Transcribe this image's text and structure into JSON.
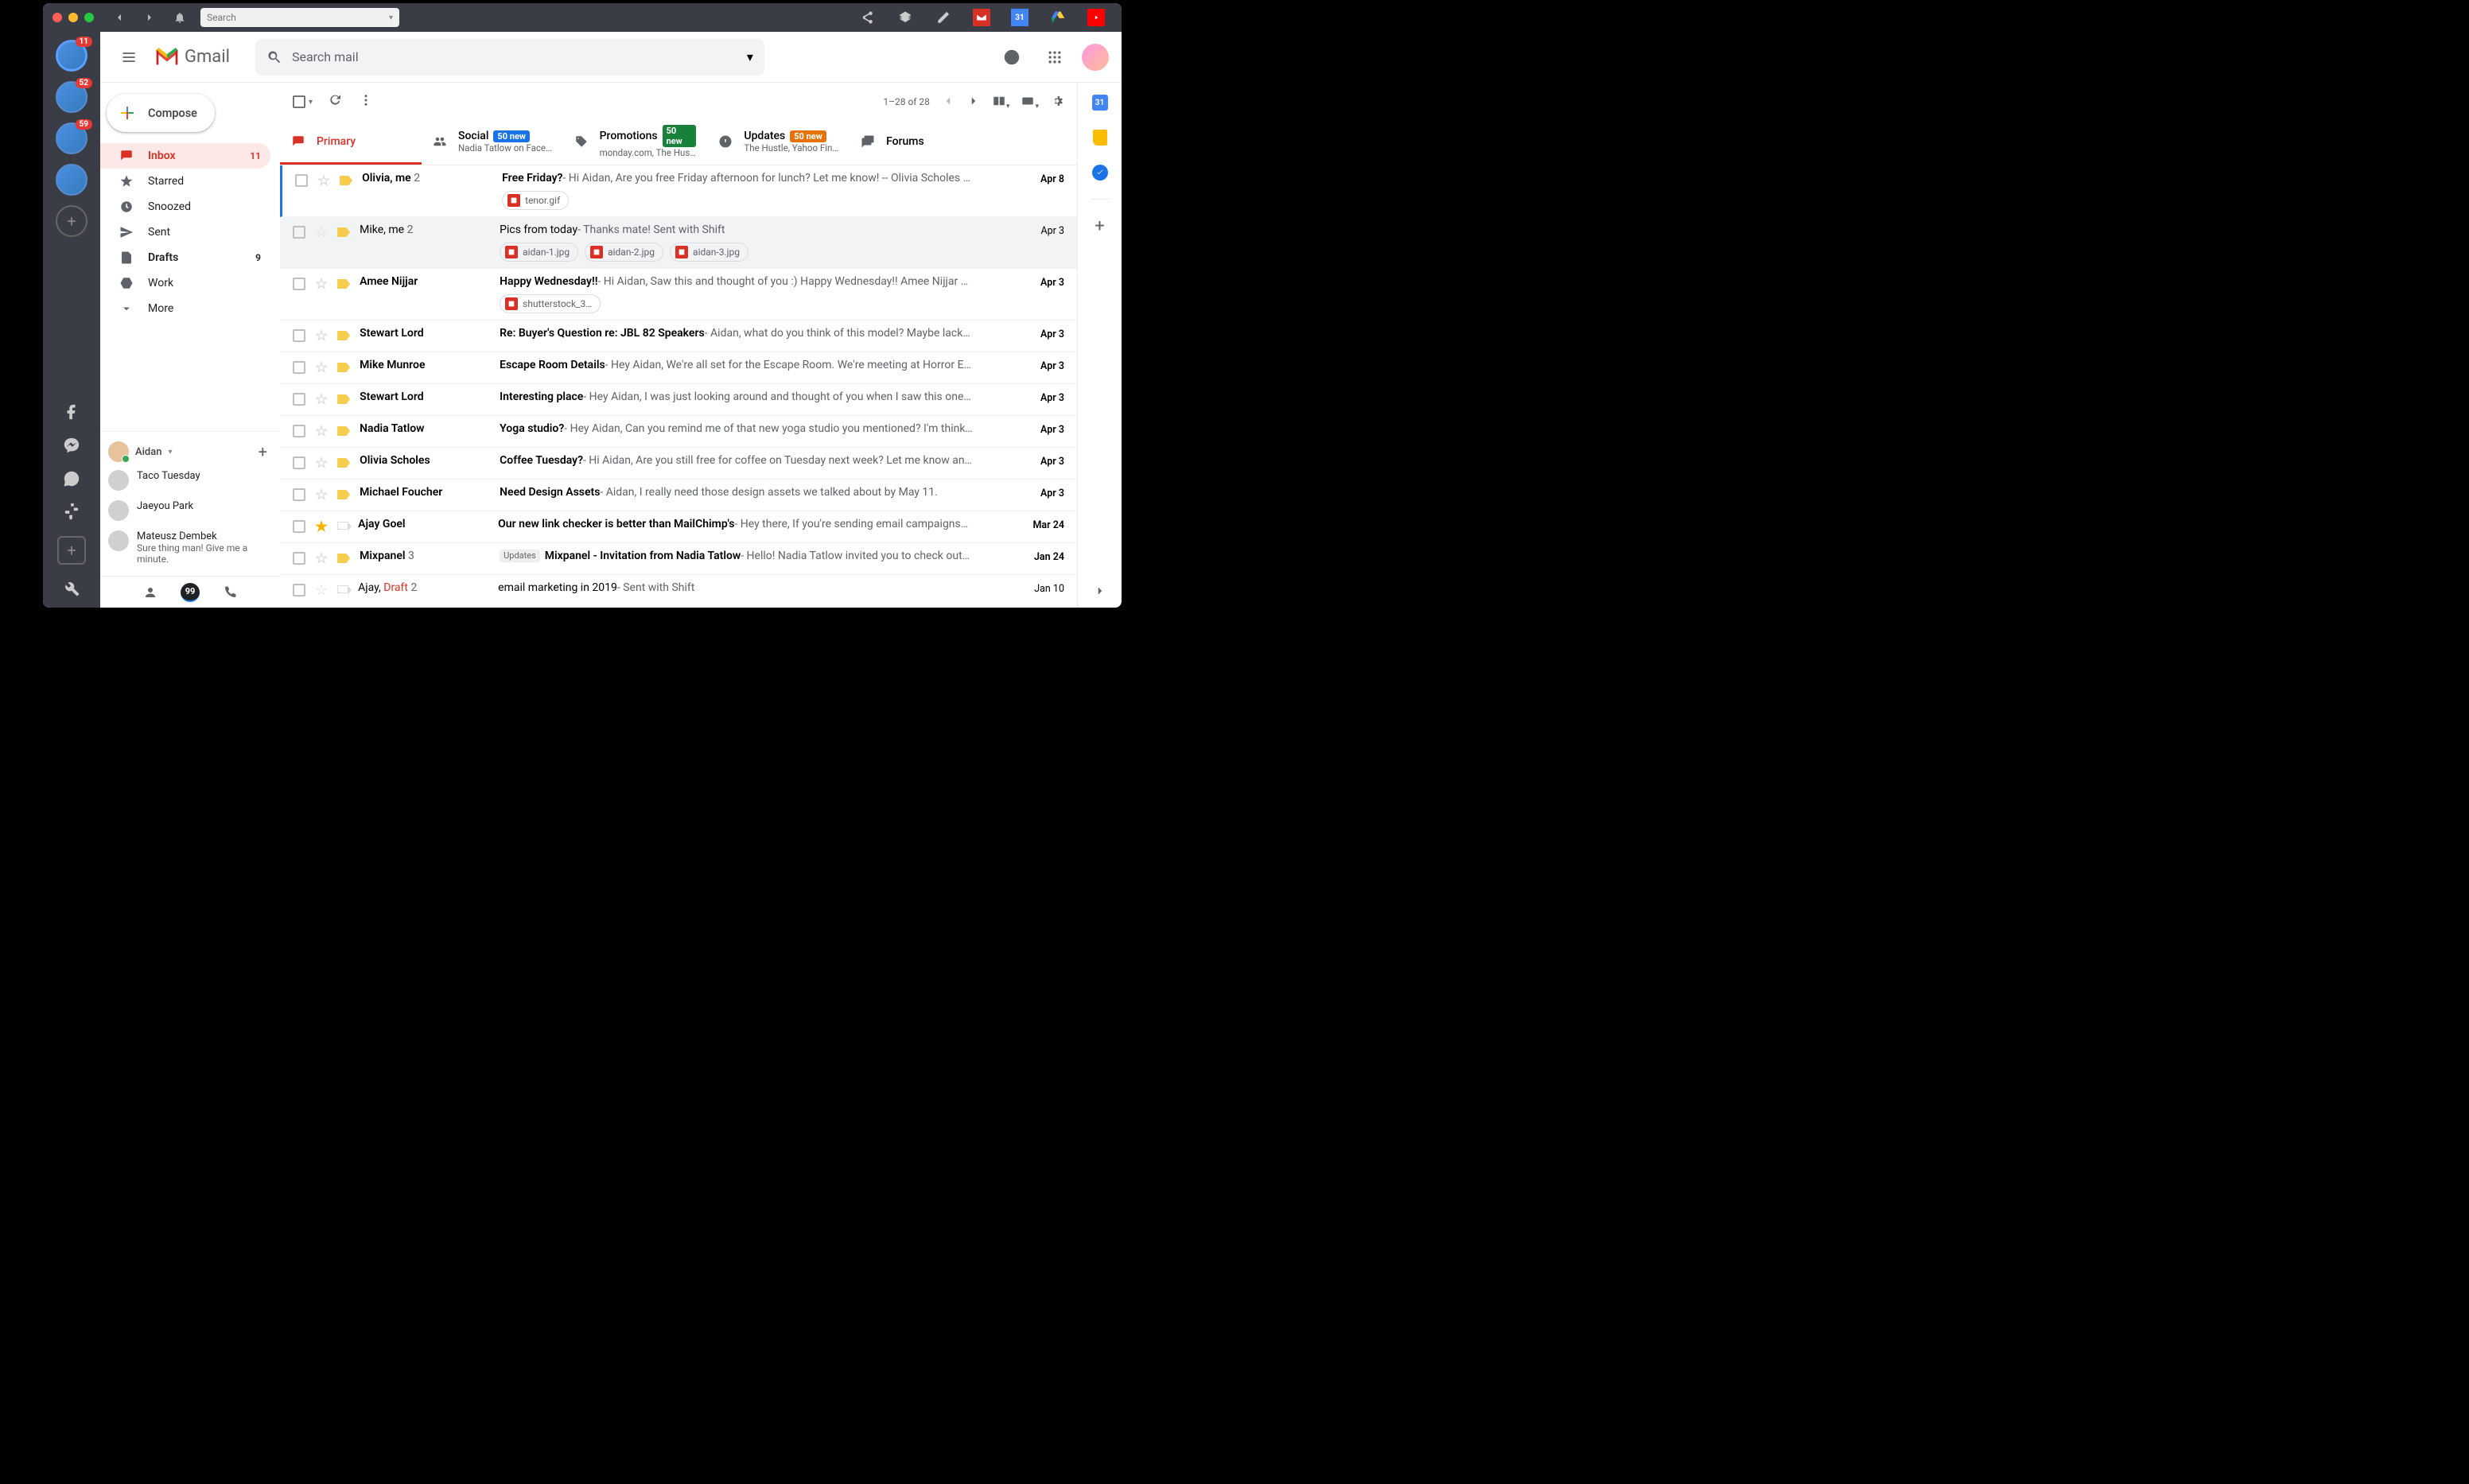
{
  "titlebar": {
    "search_placeholder": "Search"
  },
  "shift_sidebar": {
    "accounts": [
      {
        "badge": "11"
      },
      {
        "badge": "52"
      },
      {
        "badge": "59"
      },
      {
        "badge": null
      }
    ]
  },
  "gmail": {
    "brand": "Gmail",
    "search_placeholder": "Search mail",
    "compose": "Compose",
    "pagination": "1–28 of 28",
    "nav": {
      "inbox": {
        "label": "Inbox",
        "count": "11"
      },
      "starred": {
        "label": "Starred"
      },
      "snoozed": {
        "label": "Snoozed"
      },
      "sent": {
        "label": "Sent"
      },
      "drafts": {
        "label": "Drafts",
        "count": "9"
      },
      "work": {
        "label": "Work"
      },
      "more": {
        "label": "More"
      }
    },
    "tabs": {
      "primary": {
        "label": "Primary"
      },
      "social": {
        "label": "Social",
        "pill": "50 new",
        "sub": "Nadia Tatlow on Face…"
      },
      "promotions": {
        "label": "Promotions",
        "pill": "50 new",
        "sub": "monday.com, The Hus…"
      },
      "updates": {
        "label": "Updates",
        "pill": "50 new",
        "sub": "The Hustle, Yahoo Fin…"
      },
      "forums": {
        "label": "Forums"
      }
    },
    "hangouts": {
      "me": "Aidan",
      "contacts": [
        {
          "name": "Taco Tuesday"
        },
        {
          "name": "Jaeyou Park"
        },
        {
          "name": "Mateusz Dembek",
          "msg": "Sure thing man! Give me a minute."
        }
      ],
      "mid_badge": "99"
    },
    "side_cal": "31"
  },
  "emails": [
    {
      "sender": "Olivia, me",
      "cnt": "2",
      "subject": "Free Friday?",
      "snippet": " - Hi Aidan, Are you free Friday afternoon for lunch? Let me know! -- Olivia Scholes …",
      "date": "Apr 8",
      "unread": true,
      "important": true,
      "attachments": [
        "tenor.gif"
      ]
    },
    {
      "sender": "Mike, me",
      "cnt": "2",
      "subject": "Pics from today",
      "snippet": " - Thanks mate! Sent with Shift",
      "date": "Apr 3",
      "unread": false,
      "important": true,
      "selected": true,
      "attachments": [
        "aidan-1.jpg",
        "aidan-2.jpg",
        "aidan-3.jpg"
      ]
    },
    {
      "sender": "Amee Nijjar",
      "subject": "Happy Wednesday!!",
      "snippet": " - Hi Aidan, Saw this and thought of you :) Happy Wednesday!! Amee Nijjar …",
      "date": "Apr 3",
      "unread": true,
      "important": true,
      "attachments": [
        "shutterstock_3…"
      ]
    },
    {
      "sender": "Stewart Lord",
      "subject": "Re: Buyer's Question re: JBL 82 Speakers",
      "snippet": " - Aidan, what do you think of this model? Maybe lack…",
      "date": "Apr 3",
      "unread": true,
      "important": true
    },
    {
      "sender": "Mike Munroe",
      "subject": "Escape Room Details",
      "snippet": " - Hey Aidan, We're all set for the Escape Room. We're meeting at Horror E…",
      "date": "Apr 3",
      "unread": true,
      "important": true
    },
    {
      "sender": "Stewart Lord",
      "subject": "Interesting place",
      "snippet": " - Hey Aidan, I was just looking around and thought of you when I saw this one…",
      "date": "Apr 3",
      "unread": true,
      "important": true
    },
    {
      "sender": "Nadia Tatlow",
      "subject": "Yoga studio?",
      "snippet": " - Hey Aidan, Can you remind me of that new yoga studio you mentioned? I'm think…",
      "date": "Apr 3",
      "unread": true,
      "important": true
    },
    {
      "sender": "Olivia Scholes",
      "subject": "Coffee Tuesday?",
      "snippet": " - Hi Aidan, Are you still free for coffee on Tuesday next week? Let me know an…",
      "date": "Apr 3",
      "unread": true,
      "important": true
    },
    {
      "sender": "Michael Foucher",
      "subject": "Need Design Assets",
      "snippet": " - Aidan, I really need those design assets we talked about by May 11.",
      "date": "Apr 3",
      "unread": true,
      "important": true
    },
    {
      "sender": "Ajay Goel",
      "subject": "Our new link checker is better than MailChimp's",
      "snippet": " - Hey there, If you're sending email campaigns…",
      "date": "Mar 24",
      "unread": true,
      "important": false,
      "starred": true
    },
    {
      "sender": "Mixpanel",
      "cnt": "3",
      "subject": "Mixpanel - Invitation from Nadia Tatlow",
      "snippet": " - Hello! Nadia Tatlow invited you to check out…",
      "date": "Jan 24",
      "unread": true,
      "important": true,
      "label": "Updates"
    },
    {
      "sender": "Ajay, ",
      "draft": "Draft",
      "cnt": "2",
      "subject": "email marketing in 2019",
      "snippet": " - Sent with Shift",
      "date": "Jan 10",
      "unread": false,
      "important": false
    }
  ]
}
